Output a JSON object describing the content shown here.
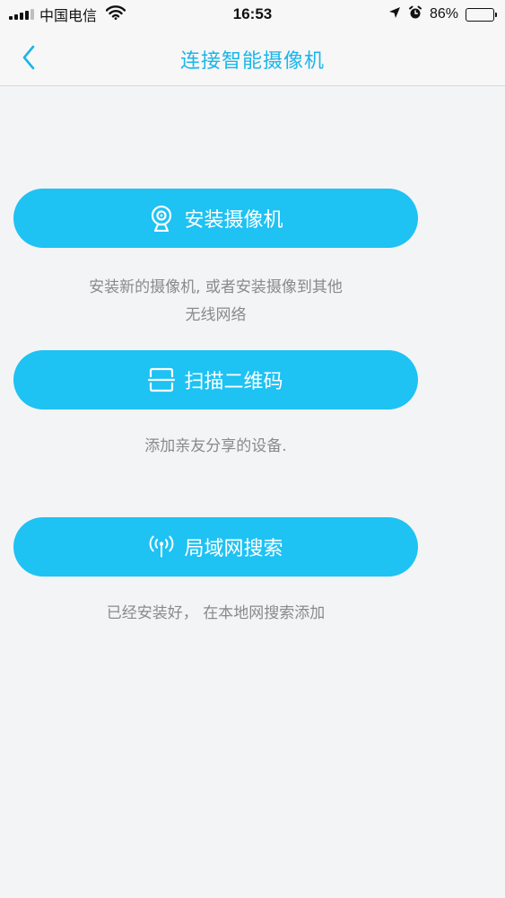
{
  "status_bar": {
    "carrier": "中国电信",
    "time": "16:53",
    "battery_percent": "86%",
    "battery_level": 0.86,
    "signal_bars": 4,
    "signal_bars_total": 5
  },
  "nav": {
    "title": "连接智能摄像机",
    "back_icon": "chevron-left-icon"
  },
  "actions": [
    {
      "id": "install-camera",
      "icon": "webcam-icon",
      "label": "安装摄像机",
      "description_lines": [
        "安装新的摄像机, 或者安装摄像到其他",
        "无线网络"
      ]
    },
    {
      "id": "scan-qr",
      "icon": "scan-icon",
      "label": "扫描二维码",
      "description_lines": [
        "添加亲友分享的设备."
      ]
    },
    {
      "id": "lan-search",
      "icon": "broadcast-antenna-icon",
      "label": "局域网搜索",
      "description_lines": [
        "已经安装好， 在本地网搜索添加"
      ]
    }
  ],
  "colors": {
    "accent": "#1ec2f3",
    "title": "#1ab6e8",
    "description": "#8a8a8a",
    "background": "#f3f4f6"
  }
}
